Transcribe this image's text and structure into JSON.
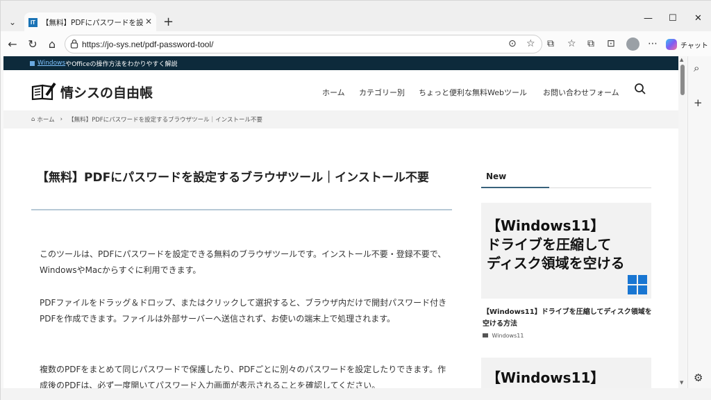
{
  "browser": {
    "tab": {
      "favicon_text": "IT",
      "title": "【無料】PDFにパスワードを設定するブラ",
      "close": "✕"
    },
    "tab_list_glyph": "⌄",
    "new_tab_glyph": "+",
    "window_controls": {
      "minimize": "—",
      "maximize": "☐",
      "close": "✕"
    },
    "nav": {
      "back": "←",
      "refresh": "↻",
      "home": "⌂"
    },
    "url": "https://jo-sys.net/pdf-password-tool/",
    "omnibox_icons": {
      "read_aloud": "⊙",
      "favorite": "☆"
    },
    "toolbar_icons": {
      "split": "⧉",
      "favorites": "☆",
      "collections": "⧉",
      "screenshot": "⊡",
      "more": "⋯"
    },
    "copilot_label": "チャット",
    "sidebar_icons": {
      "search": "⌕",
      "add": "+",
      "settings": "⚙"
    }
  },
  "site": {
    "topbar": {
      "link": "Windows",
      "rest": "やOfficeの操作方法をわかりやすく解説"
    },
    "name": "情シスの自由帳",
    "nav": [
      "ホーム",
      "カテゴリー別",
      "ちょっと便利な無料Webツール",
      "お問い合わせフォーム"
    ],
    "breadcrumb": {
      "home": "ホーム",
      "sep": "›",
      "current": "【無料】PDFにパスワードを設定するブラウザツール｜インストール不要"
    }
  },
  "article": {
    "title": "【無料】PDFにパスワードを設定するブラウザツール｜インストール不要",
    "paragraphs": [
      "このツールは、PDFにパスワードを設定できる無料のブラウザツールです。インストール不要・登録不要で、WindowsやMacからすぐに利用できます。",
      "PDFファイルをドラッグ＆ドロップ、またはクリックして選択すると、ブラウザ内だけで開封パスワード付きPDFを作成できます。ファイルは外部サーバーへ送信されず、お使いの端末上で処理されます。",
      "複数のPDFをまとめて同じパスワードで保護したり、PDFごとに別々のパスワードを設定したりできます。作成後のPDFは、必ず一度開いてパスワード入力画面が表示されることを確認してください。"
    ]
  },
  "sidebar": {
    "heading": "New",
    "cards": [
      {
        "thumb_lines": [
          "【Windows11】",
          "ドライブを圧縮して",
          "ディスク領域を空ける"
        ],
        "title": "【Windows11】ドライブを圧縮してディスク領域を空ける方法",
        "category": "Windows11"
      },
      {
        "thumb_lines": [
          "【Windows11】"
        ]
      }
    ]
  },
  "scrollbar": {
    "up": "▲",
    "down": "▼"
  }
}
